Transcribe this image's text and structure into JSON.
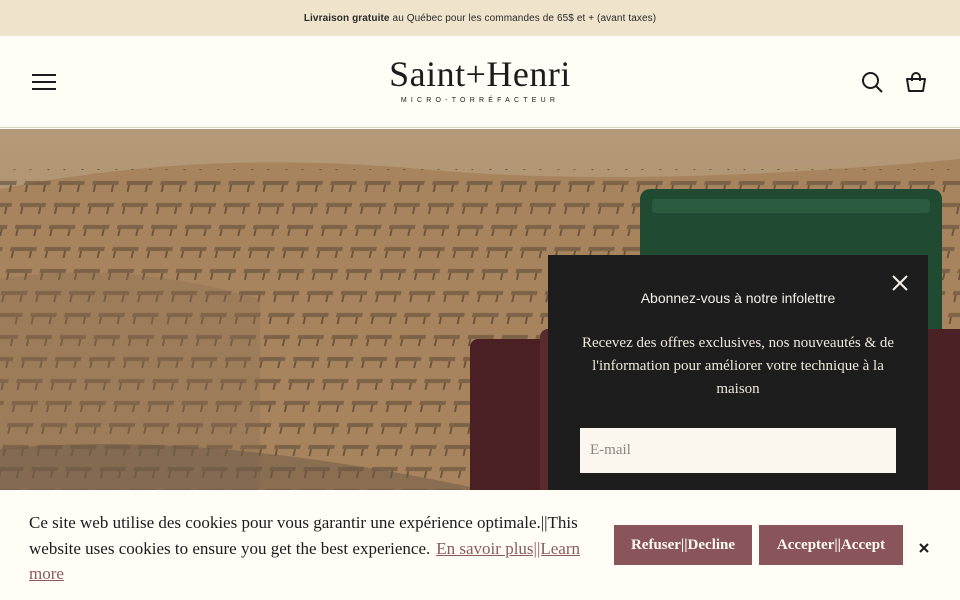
{
  "announcement": {
    "bold": "Livraison gratuite",
    "rest": "au Québec pour les commandes de 65$ et + (avant taxes)"
  },
  "header": {
    "logo_main": "Saint+Henri",
    "logo_sub": "MICRO-TORRÉFACTEUR",
    "icons": [
      "menu-icon",
      "search-icon",
      "cart-icon"
    ]
  },
  "popup": {
    "title": "Abonnez-vous à notre infolettre",
    "text": "Recevez des offres exclusives, nos nouveautés & de l'information pour améliorer votre technique à la maison",
    "email_placeholder": "E-mail"
  },
  "cookie": {
    "text": "Ce site web utilise des cookies pour vous garantir une expérience optimale.||This website uses cookies to ensure you get the best experience.",
    "link": "En savoir plus||Learn more",
    "refuse": "Refuser||Decline",
    "accept": "Accepter||Accept"
  },
  "colors": {
    "announcement_bg": "#efe3cc",
    "page_bg": "#fffdf6",
    "popup_bg": "#1d1d1d",
    "button_bg": "#8a555a"
  }
}
